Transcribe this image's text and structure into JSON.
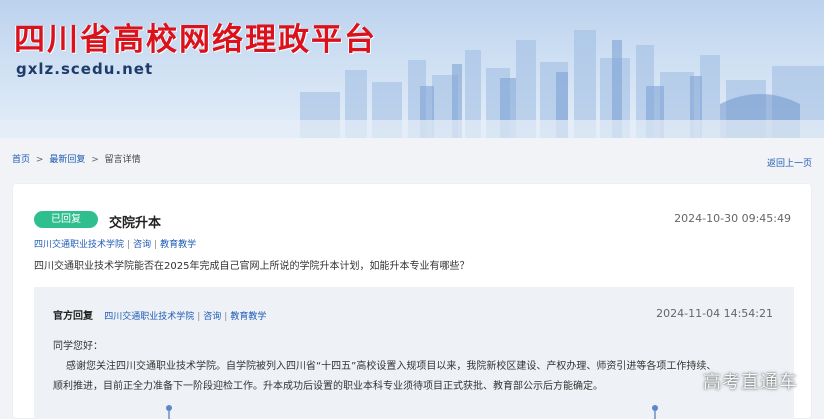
{
  "header": {
    "site_title": "四川省高校网络理政平台",
    "site_url": "gxlz.scedu.net"
  },
  "breadcrumb": {
    "home": "首页",
    "latest": "最新回复",
    "current": "留言详情",
    "separator": ">"
  },
  "back_link": "返回上一页",
  "question": {
    "status_badge": "已回复",
    "title": "交院升本",
    "time": "2024-10-30 09:45:49",
    "school": "四川交通职业技术学院",
    "type": "咨询",
    "category": "教育教学",
    "separator": "|",
    "body": "四川交通职业技术学院能否在2025年完成自己官网上所说的学院升本计划，如能升本专业有哪些？"
  },
  "reply": {
    "label": "官方回复",
    "school": "四川交通职业技术学院",
    "type": "咨询",
    "category": "教育教学",
    "separator": "|",
    "time": "2024-11-04 14:54:21",
    "greeting": "同学您好：",
    "line1": "感谢您关注四川交通职业技术学院。自学院被列入四川省“十四五”高校设置入规项目以来，我院新校区建设、产权办理、师资引进等各项工作持续、",
    "line2": "顺利推进，目前正全力准备下一阶段迎检工作。升本成功后设置的职业本科专业须待项目正式获批、教育部公示后方能确定。"
  },
  "watermark": "高考直通车",
  "colors": {
    "title_red": "#d9121b",
    "link_blue": "#1f5bb5",
    "badge_green": "#2fbf8f",
    "reply_bg": "#eef2f7"
  }
}
